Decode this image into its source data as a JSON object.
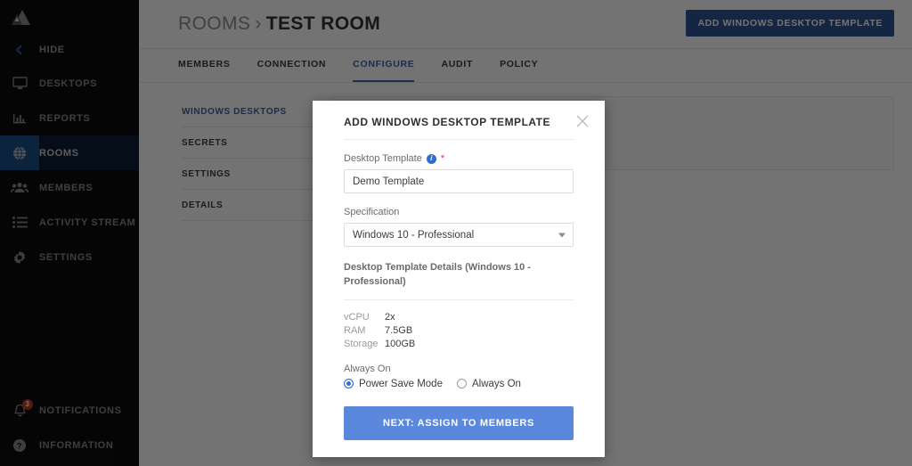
{
  "sidebar": {
    "logo": "mountain-logo",
    "hide": {
      "label": "HIDE",
      "icon": "chevron-left-icon"
    },
    "items": [
      {
        "label": "DESKTOPS",
        "icon": "monitor-icon",
        "active": false
      },
      {
        "label": "REPORTS",
        "icon": "bar-chart-icon",
        "active": false
      },
      {
        "label": "ROOMS",
        "icon": "globe-icon",
        "active": true
      },
      {
        "label": "MEMBERS",
        "icon": "people-icon",
        "active": false
      },
      {
        "label": "ACTIVITY STREAM",
        "icon": "list-icon",
        "active": false
      },
      {
        "label": "SETTINGS",
        "icon": "gear-icon",
        "active": false
      }
    ],
    "bottom": [
      {
        "label": "NOTIFICATIONS",
        "icon": "bell-icon",
        "badge": "3"
      },
      {
        "label": "INFORMATION",
        "icon": "question-circle-icon",
        "badge": ""
      }
    ]
  },
  "header": {
    "breadcrumb_parent": "ROOMS",
    "breadcrumb_separator": "›",
    "breadcrumb_current": "TEST ROOM",
    "action_button": "ADD WINDOWS DESKTOP TEMPLATE"
  },
  "tabs": [
    {
      "label": "MEMBERS",
      "active": false
    },
    {
      "label": "CONNECTION",
      "active": false
    },
    {
      "label": "CONFIGURE",
      "active": true
    },
    {
      "label": "AUDIT",
      "active": false
    },
    {
      "label": "POLICY",
      "active": false
    }
  ],
  "submenu": [
    {
      "label": "WINDOWS DESKTOPS",
      "active": true,
      "chevron": "›"
    },
    {
      "label": "SECRETS",
      "active": false,
      "chevron": ""
    },
    {
      "label": "SETTINGS",
      "active": false,
      "chevron": ""
    },
    {
      "label": "DETAILS",
      "active": false,
      "chevron": ""
    }
  ],
  "modal": {
    "title": "ADD WINDOWS DESKTOP TEMPLATE",
    "close_icon": "close-icon",
    "desktop_template": {
      "label": "Desktop Template",
      "info_icon": "info-icon",
      "required_marker": "*",
      "value": "Demo Template",
      "placeholder": "Desktop Template"
    },
    "specification": {
      "label": "Specification",
      "value": "Windows 10 - Professional",
      "options": [
        "Windows 10 - Professional"
      ]
    },
    "details": {
      "title": "Desktop Template Details (Windows 10 - Professional)",
      "rows": [
        {
          "key": "vCPU",
          "value": "2x"
        },
        {
          "key": "RAM",
          "value": "7.5GB"
        },
        {
          "key": "Storage",
          "value": "100GB"
        }
      ]
    },
    "always_on": {
      "label": "Always On",
      "options": [
        {
          "label": "Power Save Mode",
          "selected": true
        },
        {
          "label": "Always On",
          "selected": false
        }
      ]
    },
    "submit_label": "NEXT: ASSIGN TO MEMBERS"
  },
  "colors": {
    "accent_blue": "#3f63b0",
    "button_blue": "#5b87dc",
    "sidebar_bg": "#0d0d0f",
    "sidebar_active": "#0c2136",
    "sidebar_active_icon": "#1a4f86",
    "badge_red": "#c0392b",
    "required_red": "#e03b32",
    "info_blue": "#2b6fd4"
  }
}
